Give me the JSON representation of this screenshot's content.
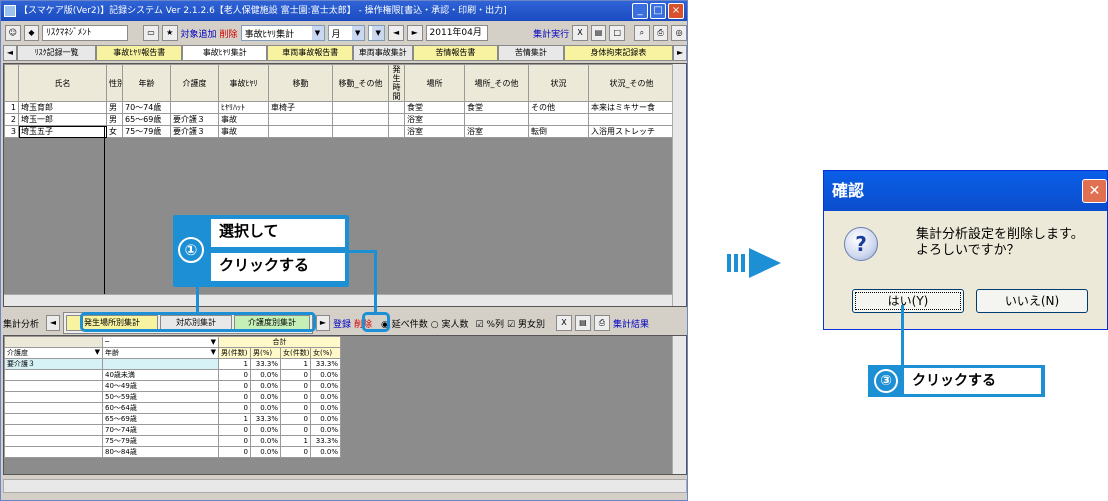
{
  "app": {
    "title": "【スマケア版(Ver2)】記録システム Ver 2.1.2.6【老人保健施設 富士園:富士太郎】 - 操作権限[書込・承認・印刷・出力]",
    "window_buttons": {
      "min": "_",
      "max": "□",
      "close": "×"
    }
  },
  "toolbar": {
    "risk_label": "ﾘｽｸﾏﾈｼﾞﾒﾝﾄ",
    "add_target": "対象追加",
    "delete": "削除",
    "report_type": "事故ﾋﾔﾘ集計",
    "period": "月",
    "date": "2011年04月",
    "run": "集計実行"
  },
  "tabs": [
    "ﾘｽｸ記録一覧",
    "事故ﾋﾔﾘ報告書",
    "事故ﾋﾔﾘ集計",
    "車両事故報告書",
    "車両事故集計",
    "苦情報告書",
    "苦情集計",
    "身体拘束記録表"
  ],
  "grid1": {
    "headers": [
      "氏名",
      "性別",
      "年齢",
      "介護度",
      "事故ﾋﾔﾘ",
      "移動",
      "移動_その他",
      "発生時間",
      "場所",
      "場所_その他",
      "状況",
      "状況_その他"
    ],
    "rows": [
      {
        "no": "1",
        "cells": [
          "埼玉育郎",
          "男",
          "70～74歳",
          "",
          "ﾋﾔﾘﾊｯﾄ",
          "車椅子",
          "",
          "",
          "食堂",
          "食堂",
          "その他",
          "本来はミキサー食"
        ]
      },
      {
        "no": "2",
        "cells": [
          "埼玉一郎",
          "男",
          "65～69歳",
          "要介護３",
          "事故",
          "",
          "",
          "",
          "浴室",
          "",
          "",
          ""
        ]
      },
      {
        "no": "3",
        "cells": [
          "埼玉五子",
          "女",
          "75～79歳",
          "要介護３",
          "事故",
          "",
          "",
          "",
          "浴室",
          "浴室",
          "転倒",
          "入浴用ストレッチ"
        ]
      }
    ]
  },
  "analysis": {
    "label": "集計分析",
    "tabs": [
      "発生場所別集計",
      "対応別集計",
      "介護度別集計"
    ],
    "register": "登録",
    "delete": "削除",
    "radio1": "延べ件数",
    "radio2": "実人数",
    "check1": "%列",
    "check2": "男女別",
    "result": "集計結果"
  },
  "grid2": {
    "filter": "─",
    "col1": "介護度",
    "col2": "年齢",
    "total": "合計",
    "sub_headers": [
      "男(件数)",
      "男(%)",
      "女(件数)",
      "女(%)"
    ],
    "group": "要介護３",
    "rows": [
      {
        "label": "",
        "v": [
          "1",
          "33.3%",
          "1",
          "33.3%"
        ]
      },
      {
        "label": "40歳未満",
        "v": [
          "0",
          "0.0%",
          "0",
          "0.0%"
        ]
      },
      {
        "label": "40～49歳",
        "v": [
          "0",
          "0.0%",
          "0",
          "0.0%"
        ]
      },
      {
        "label": "50～59歳",
        "v": [
          "0",
          "0.0%",
          "0",
          "0.0%"
        ]
      },
      {
        "label": "60～64歳",
        "v": [
          "0",
          "0.0%",
          "0",
          "0.0%"
        ]
      },
      {
        "label": "65～69歳",
        "v": [
          "1",
          "33.3%",
          "0",
          "0.0%"
        ]
      },
      {
        "label": "70～74歳",
        "v": [
          "0",
          "0.0%",
          "0",
          "0.0%"
        ]
      },
      {
        "label": "75～79歳",
        "v": [
          "0",
          "0.0%",
          "1",
          "33.3%"
        ]
      },
      {
        "label": "80～84歳",
        "v": [
          "0",
          "0.0%",
          "0",
          "0.0%"
        ]
      }
    ]
  },
  "callout1": {
    "num": "①",
    "line1": "選択して",
    "line2": "クリックする"
  },
  "callout3": {
    "num": "③",
    "text": "クリックする"
  },
  "dialog": {
    "title": "確認",
    "message1": "集計分析設定を削除します。",
    "message2": "よろしいですか？",
    "yes": "はい(Y)",
    "no": "いいえ(N)",
    "icon": "?"
  },
  "colors": {
    "accent": "#1d8fd4",
    "title_blue": "#1b4bc0"
  }
}
